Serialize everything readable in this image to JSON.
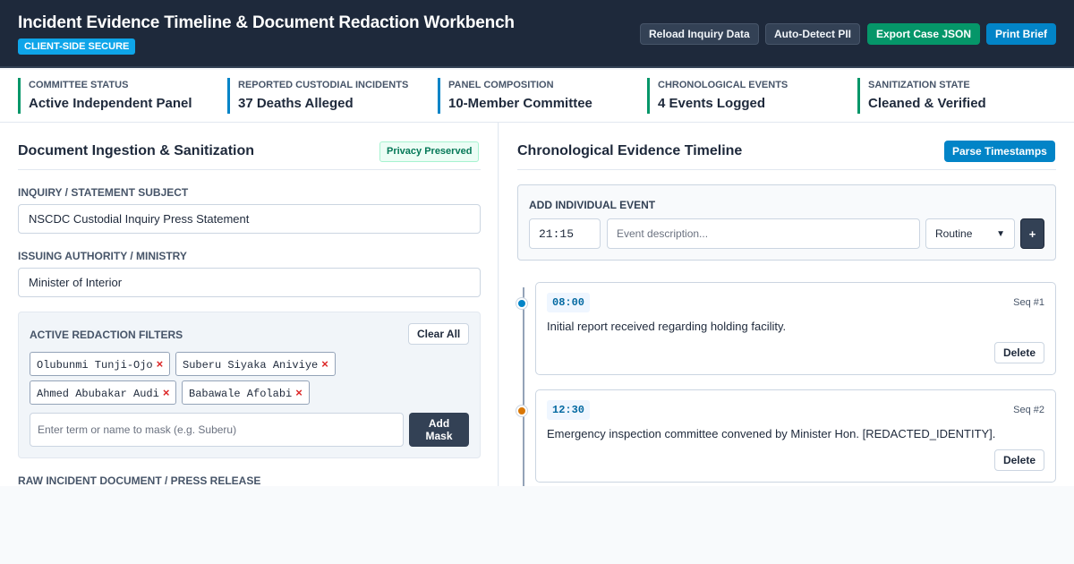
{
  "header": {
    "title": "Incident Evidence Timeline & Document Redaction Workbench",
    "badge": "CLIENT-SIDE SECURE",
    "buttons": {
      "reload": "Reload Inquiry Data",
      "auto_detect": "Auto-Detect PII",
      "export": "Export Case JSON",
      "print": "Print Brief"
    }
  },
  "stats": [
    {
      "label": "COMMITTEE STATUS",
      "value": "Active Independent Panel"
    },
    {
      "label": "REPORTED CUSTODIAL INCIDENTS",
      "value": "37 Deaths Alleged"
    },
    {
      "label": "PANEL COMPOSITION",
      "value": "10-Member Committee"
    },
    {
      "label": "CHRONOLOGICAL EVENTS",
      "value": "4 Events Logged"
    },
    {
      "label": "SANITIZATION STATE",
      "value": "Cleaned & Verified"
    }
  ],
  "left_panel": {
    "title": "Document Ingestion & Sanitization",
    "badge": "Privacy Preserved",
    "subject_label": "INQUIRY / STATEMENT SUBJECT",
    "subject_value": "NSCDC Custodial Inquiry Press Statement",
    "authority_label": "ISSUING AUTHORITY / MINISTRY",
    "authority_value": "Minister of Interior",
    "filters": {
      "title": "ACTIVE REDACTION FILTERS",
      "clear_label": "Clear All",
      "terms": [
        "Olubunmi Tunji-Ojo",
        "Suberu Siyaka Aniviye",
        "Ahmed Abubakar Audi",
        "Babawale Afolabi"
      ],
      "remove_glyph": "×",
      "mask_placeholder": "Enter term or name to mask (e.g. Suberu)",
      "add_mask_line1": "Add",
      "add_mask_line2": "Mask"
    },
    "raw_doc_label": "RAW INCIDENT DOCUMENT / PRESS RELEASE"
  },
  "right_panel": {
    "title": "Chronological Evidence Timeline",
    "parse_label": "Parse Timestamps",
    "add_event": {
      "title": "ADD INDIVIDUAL EVENT",
      "time_value": "21:15",
      "desc_placeholder": "Event description...",
      "severity_value": "Routine",
      "add_label": "+"
    },
    "events": [
      {
        "time": "08:00",
        "seq": "Seq #1",
        "desc": "Initial report received regarding holding facility.",
        "delete_label": "Delete",
        "dot_color": "#0284c7"
      },
      {
        "time": "12:30",
        "seq": "Seq #2",
        "desc": "Emergency inspection committee convened by Minister Hon. [REDACTED_IDENTITY].",
        "delete_label": "Delete",
        "dot_color": "#d97706"
      }
    ]
  }
}
